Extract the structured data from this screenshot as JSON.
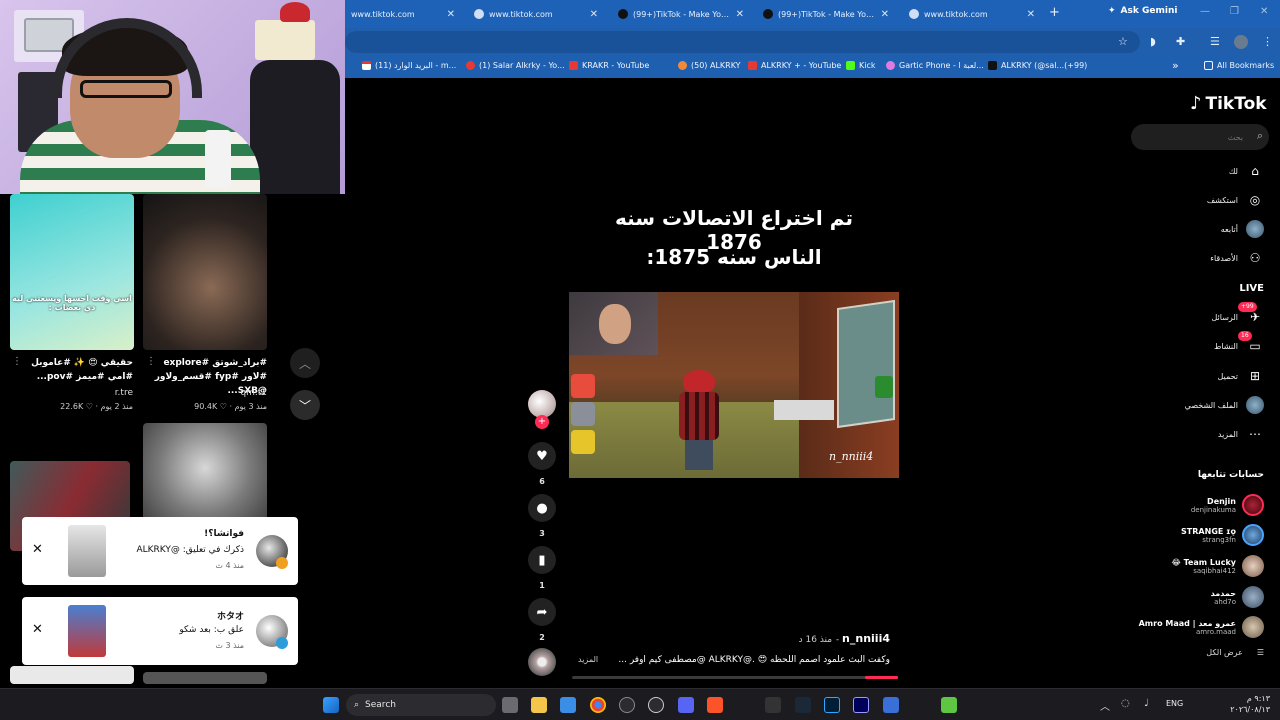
{
  "browser": {
    "tabs": [
      {
        "title": "www.tiktok.com"
      },
      {
        "title": "www.tiktok.com"
      },
      {
        "title": "(99+)TikTok - Make Your Day"
      },
      {
        "title": "(99+)TikTok - Make Your Day"
      },
      {
        "title": "www.tiktok.com"
      }
    ],
    "new_tab": "+",
    "ask_gemini": "Ask Gemini",
    "bookmarks": [
      {
        "label": "البريد الوارد (11) - m..."
      },
      {
        "label": "(1) Salar Alkrky - Yo..."
      },
      {
        "label": "KRAKR - YouTube"
      },
      {
        "label": "(50) ALKRKY"
      },
      {
        "label": "ALKRKY + - YouTube"
      },
      {
        "label": "Kick"
      },
      {
        "label": "Gartic Phone - لعبة ا..."
      },
      {
        "label": "ALKRKY (@sal...(+99)"
      }
    ],
    "bookmarks_more": "»",
    "all_bookmarks": "All Bookmarks"
  },
  "feed": {
    "videos": [
      {
        "title": "حقيقي 😍 ✨ #عاموبل #امي #ميمز #pov...",
        "user": "r.tre",
        "views": "22.6K",
        "time": "منذ 2 يوم"
      },
      {
        "title": "#براد_شوتق #explore #لاور #fyp #قسم_ولاور @SXB...",
        "user": "qm.t2",
        "views": "90.4K",
        "time": "منذ 3 يوم"
      }
    ],
    "thumb_caption": "اسي وقت احسها ويسعتني ليه  دي بعضات :",
    "nav_up": "︿",
    "nav_down": "﹀"
  },
  "notifications": [
    {
      "title": "فواتشا؟!",
      "message": "ذكرك في تعليق: @ALKRKY",
      "time": "منذ 4 ث",
      "close": "✕"
    },
    {
      "title": "ホタオ",
      "message": "علق ب: بعد شكو",
      "time": "منذ 3 ث",
      "close": "✕"
    }
  ],
  "video": {
    "caption_line1": "تم اختراع الاتصالات سنه 1876",
    "caption_line2": "الناس سنه 1875:",
    "overlay_name": "n_nniii4",
    "likes": "6",
    "comments": "3",
    "saves": "1",
    "shares": "2",
    "author": "n_nniii4",
    "author_time": "منذ 16 د",
    "description": "وكفت البث علمود اصمم اللحظه 😍 .@ALKRKY @مصطفى كيم اوفر ...",
    "more": "المزيد",
    "progress": 0.1,
    "follow_plus": "+"
  },
  "sidebar": {
    "logo": "TikTok",
    "search_placeholder": "بحث",
    "nav": [
      {
        "label": "لك",
        "icon": "home-icon"
      },
      {
        "label": "استكشف",
        "icon": "compass-icon"
      },
      {
        "label": "أتابعه",
        "icon": "following-icon"
      },
      {
        "label": "الأصدقاء",
        "icon": "friends-icon"
      },
      {
        "label": "LIVE",
        "icon": "live-icon"
      },
      {
        "label": "الرسائل",
        "icon": "messages-icon",
        "badge": "+99"
      },
      {
        "label": "النشاط",
        "icon": "activity-icon",
        "badge": "16"
      },
      {
        "label": "تحميل",
        "icon": "upload-icon"
      },
      {
        "label": "الملف الشخصي",
        "icon": "profile-icon"
      },
      {
        "label": "المزيد",
        "icon": "more-icon"
      }
    ],
    "following_header": "حسابات تتابعها",
    "following": [
      {
        "name": "Denjin",
        "handle": "denjinakuma"
      },
      {
        "name": "STRANGE ɪǫ",
        "handle": "strang3fn"
      },
      {
        "name": "😂 Team Lucky",
        "handle": "saqibhai412"
      },
      {
        "name": "حمدمد",
        "handle": "ahd7o"
      },
      {
        "name": "Amro Maad | عمرو معد",
        "handle": "amro.maad"
      }
    ],
    "see_all": "عرض الكل"
  },
  "taskbar": {
    "search": "Search",
    "lang": "ENG",
    "time": "٩:١٣ م",
    "date": "٢٠٢٦/٠٨/١٣"
  },
  "colors": {
    "accent": "#fe2c55",
    "browser_blue": "#1e62b8",
    "taskbar": "#1c1c20"
  }
}
